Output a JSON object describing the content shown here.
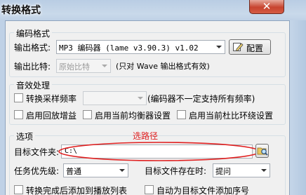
{
  "window": {
    "title": "转换格式",
    "close_label": "✕"
  },
  "encoding": {
    "group_title": "编码格式",
    "format_label": "输出格式:",
    "format_value": "MP3 编码器 (lame v3.90.3) v1.02",
    "config_button": "配置",
    "bitrate_label": "输出比特:",
    "bitrate_value": "原始比特",
    "bitrate_note": "(只对 Wave 输出格式有效)"
  },
  "effects": {
    "group_title": "音效处理",
    "resample_label": "转换采样频率",
    "resample_value": "",
    "resample_note": "(编码器不一定支持所有频率)",
    "replaygain_label": "启用回放增益",
    "equalizer_label": "启用当前均衡器设置",
    "surround_label": "启用当前杜比环绕设置"
  },
  "options": {
    "group_title": "选项",
    "annotation": "选路径",
    "annotation_color": "#e02020",
    "target_folder_label": "目标文件夹:",
    "target_folder_value": "C:\\",
    "priority_label": "任务优先级:",
    "priority_value": "普通",
    "exists_label": "目标文件存在时:",
    "exists_value": "提问",
    "add_to_playlist_label": "转换完成后添加到播放列表",
    "auto_number_label": "自动为目标文件添加序号"
  }
}
